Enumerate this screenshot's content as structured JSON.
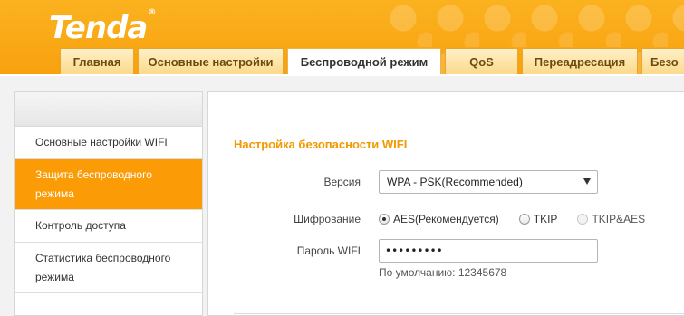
{
  "brand": {
    "name": "Tenda",
    "trademark": "®"
  },
  "tabs": [
    {
      "label": "Главная",
      "active": false
    },
    {
      "label": "Основные настройки",
      "active": false
    },
    {
      "label": "Беспроводной режим",
      "active": true
    },
    {
      "label": "QoS",
      "active": false
    },
    {
      "label": "Переадресация",
      "active": false
    },
    {
      "label": "Безо",
      "active": false
    }
  ],
  "sidebar": {
    "items": [
      {
        "label": "Основные настройки WIFI",
        "active": false
      },
      {
        "label": "Защита беспроводного режима",
        "active": true
      },
      {
        "label": "Контроль доступа",
        "active": false
      },
      {
        "label": "Статистика беспроводного режима",
        "active": false
      }
    ]
  },
  "main": {
    "section_title": "Настройка безопасности WIFI",
    "version": {
      "label": "Версия",
      "value": "WPA - PSK(Recommended)"
    },
    "encryption": {
      "label": "Шифрование",
      "options": [
        {
          "label": "AES(Рекомендуется)",
          "checked": true,
          "disabled": false
        },
        {
          "label": "TKIP",
          "checked": false,
          "disabled": false
        },
        {
          "label": "TKIP&AES",
          "checked": false,
          "disabled": true
        }
      ]
    },
    "password": {
      "label": "Пароль WIFI",
      "value": "•••••••••"
    },
    "default_hint": "По умолчанию: 12345678"
  },
  "colors": {
    "accent": "#fb9b06",
    "title": "#f39800",
    "header": "#f8a10f"
  }
}
